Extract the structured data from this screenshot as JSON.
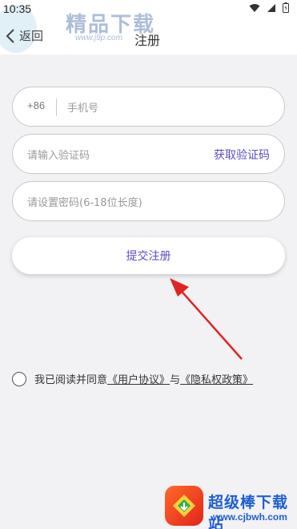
{
  "status_bar": {
    "time": "10:35"
  },
  "header": {
    "back_label": "返回",
    "title": "注册"
  },
  "watermark_top": {
    "title": "精品下载",
    "url": "www.j9p.com"
  },
  "form": {
    "phone_prefix": "+86",
    "phone_placeholder": "手机号",
    "code_placeholder": "请输入验证码",
    "get_code_label": "获取验证码",
    "password_placeholder": "请设置密码(6-18位长度)",
    "submit_label": "提交注册"
  },
  "agreement": {
    "prefix_text": "我已阅读并同意",
    "user_agreement": "《用户协议》",
    "connector": "与",
    "privacy_policy": "《隐私权政策》",
    "checked": false
  },
  "watermark_bottom": {
    "title": "超级棒下载站",
    "url": "www.cjbwh.com"
  },
  "colors": {
    "accent": "#5b4fc4",
    "arrow": "#e02424",
    "background": "#f2f2f4"
  }
}
